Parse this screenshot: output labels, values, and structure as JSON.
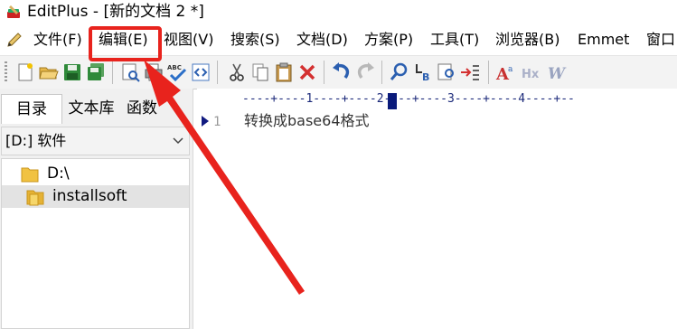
{
  "window": {
    "title": "EditPlus - [新的文档 2 *]"
  },
  "menu": {
    "items": [
      {
        "label": "文件(F)"
      },
      {
        "label": "编辑(E)"
      },
      {
        "label": "视图(V)"
      },
      {
        "label": "搜索(S)"
      },
      {
        "label": "文档(D)"
      },
      {
        "label": "方案(P)"
      },
      {
        "label": "工具(T)"
      },
      {
        "label": "浏览器(B)"
      },
      {
        "label": "Emmet"
      },
      {
        "label": "窗口"
      }
    ],
    "highlighted": "编辑(E)"
  },
  "toolbar": {
    "buttons": [
      "new-file",
      "open-folder",
      "save",
      "save-all",
      "print-preview",
      "print",
      "spell-check",
      "html-preview",
      "cut",
      "copy",
      "paste",
      "delete",
      "undo",
      "redo",
      "find",
      "replace",
      "find-in-files",
      "go-to",
      "font",
      "hex-view",
      "word-wrap"
    ],
    "abc_label": "ABC",
    "hx_label": "Hx",
    "w_label": "W"
  },
  "sidebar": {
    "tabs": [
      {
        "label": "目录"
      },
      {
        "label": "文本库"
      },
      {
        "label": "函数"
      }
    ],
    "active_tab": "目录",
    "drive": "[D:] 软件",
    "tree": [
      {
        "label": "D:\\"
      },
      {
        "label": "installsoft"
      }
    ],
    "selected": "installsoft"
  },
  "editor": {
    "ruler": "----+----1----+----2----+----3----+----4----+--",
    "lines": [
      {
        "number": "1",
        "text": "转换成base64格式"
      }
    ]
  },
  "annotation": {
    "color": "#e8231d"
  }
}
